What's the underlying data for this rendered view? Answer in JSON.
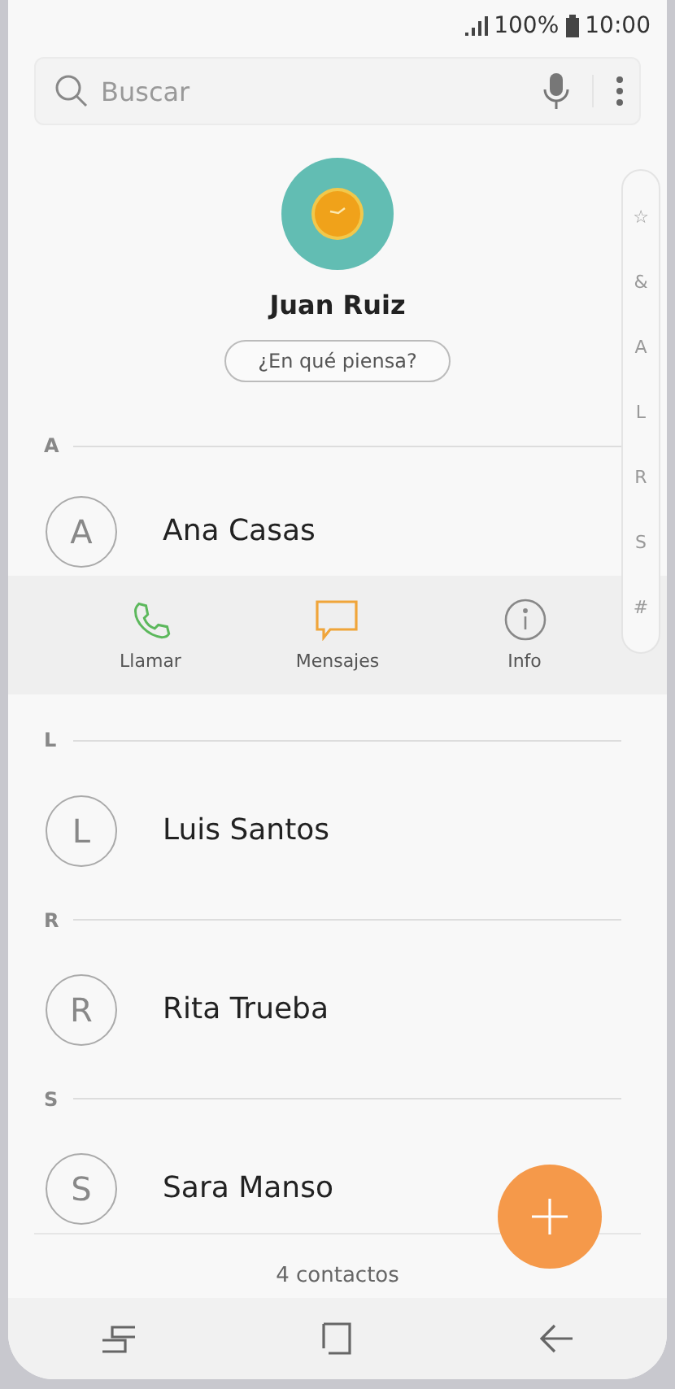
{
  "status_bar": {
    "battery": "100%",
    "time": "10:00"
  },
  "search": {
    "placeholder": "Buscar"
  },
  "profile": {
    "name": "Juan Ruiz",
    "status_button": "¿En qué piensa?"
  },
  "index": [
    "☆",
    "&",
    "A",
    "L",
    "R",
    "S",
    "#"
  ],
  "sections": [
    {
      "letter": "A",
      "contacts": [
        {
          "initial": "A",
          "name": "Ana Casas",
          "expanded": true
        }
      ]
    },
    {
      "letter": "L",
      "contacts": [
        {
          "initial": "L",
          "name": "Luis Santos",
          "expanded": false
        }
      ]
    },
    {
      "letter": "R",
      "contacts": [
        {
          "initial": "R",
          "name": "Rita Trueba",
          "expanded": false
        }
      ]
    },
    {
      "letter": "S",
      "contacts": [
        {
          "initial": "S",
          "name": "Sara Manso",
          "expanded": false
        }
      ]
    }
  ],
  "actions": [
    {
      "kind": "call",
      "label": "Llamar"
    },
    {
      "kind": "message",
      "label": "Mensajes"
    },
    {
      "kind": "info",
      "label": "Info"
    }
  ],
  "footer": "4 contactos"
}
